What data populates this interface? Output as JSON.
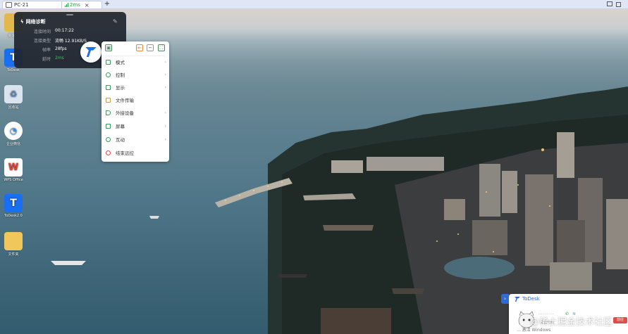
{
  "tabbar": {
    "tab_pc": {
      "label": "PC-21"
    },
    "tab_latency": {
      "label": "2ms"
    },
    "add_tab": "+"
  },
  "desktop": {
    "icons": [
      {
        "label": "高速..."
      },
      {
        "label": "ToDesk"
      },
      {
        "label": "回收站"
      },
      {
        "label": "企业微信"
      },
      {
        "label": "WPS Office"
      },
      {
        "label": "ToDesk2.0"
      },
      {
        "label": "文件夹"
      }
    ]
  },
  "diagnostics": {
    "title": "网络诊断",
    "rows": [
      {
        "key": "连接时间",
        "value": "00:17:22"
      },
      {
        "key": "连接类型",
        "value": "流畅 12.91KB/S"
      },
      {
        "key": "帧率",
        "value": "28fps"
      },
      {
        "key": "延时",
        "value": "2ms"
      }
    ]
  },
  "menu": {
    "items": [
      {
        "label": "模式",
        "has_submenu": true
      },
      {
        "label": "控制",
        "has_submenu": true
      },
      {
        "label": "显示",
        "has_submenu": true
      },
      {
        "label": "文件传输",
        "has_submenu": false
      },
      {
        "label": "外接设备",
        "has_submenu": true
      },
      {
        "label": "屏幕",
        "has_submenu": true
      },
      {
        "label": "互动",
        "has_submenu": true
      },
      {
        "label": "结束远控",
        "has_submenu": false
      }
    ]
  },
  "promo": {
    "title": "ToDesk",
    "password_mask": "--------",
    "device_code_label": "设备代码",
    "action_label": "前往",
    "footer": "... 激活 Windows"
  },
  "watermark": {
    "text": "@稀土掘金技术社区"
  },
  "colors": {
    "accent": "#2f6bd8",
    "latency_green": "#3fc26a",
    "danger": "#e14b4b"
  }
}
